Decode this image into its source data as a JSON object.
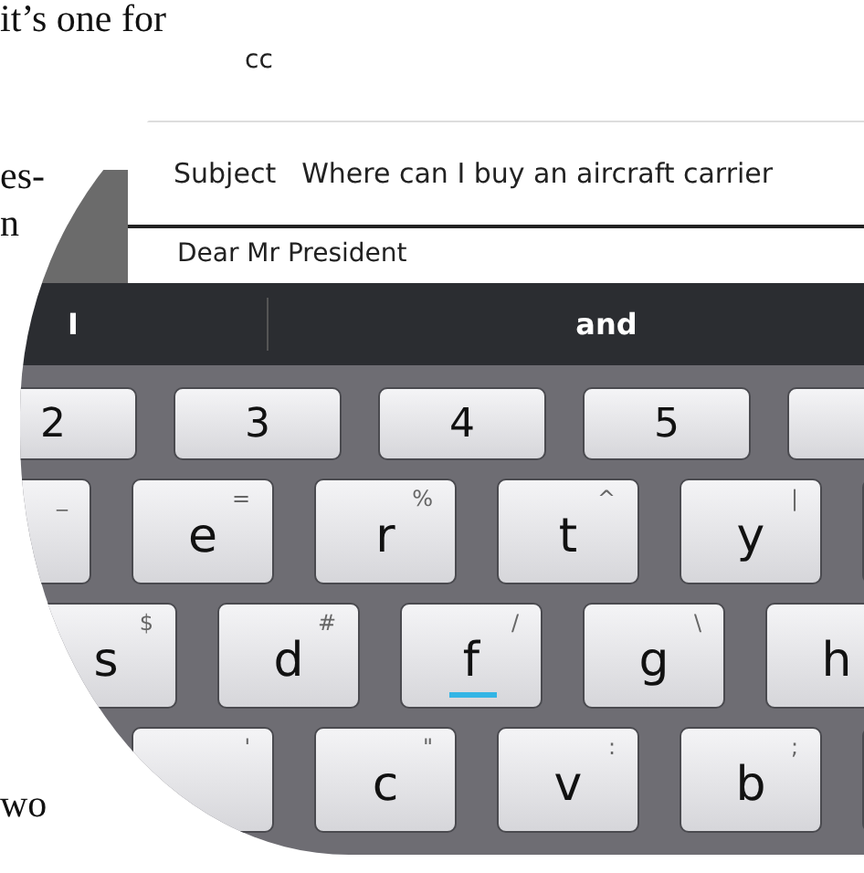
{
  "article_text": [
    "it’s one for",
    "es-",
    "n",
    "wo"
  ],
  "email": {
    "bcc_label": "cc",
    "subject_label": "Subject",
    "subject": "Where can I buy an aircraft carrier",
    "body": "Dear Mr President"
  },
  "suggestions": [
    "I",
    "and"
  ],
  "keyboard": {
    "rows": [
      [
        {
          "label": "2",
          "underlined": false
        },
        {
          "label": "3",
          "underlined": false
        },
        {
          "label": "4",
          "underlined": false
        },
        {
          "label": "5",
          "underlined": false
        },
        {
          "underlined": false
        }
      ],
      [
        {
          "alt": "_",
          "underlined": false
        },
        {
          "label": "e",
          "alt": "=",
          "underlined": false
        },
        {
          "label": "r",
          "alt": "%",
          "underlined": false
        },
        {
          "label": "t",
          "alt": "^",
          "underlined": false
        },
        {
          "label": "y",
          "alt": "|",
          "underlined": false
        },
        {
          "underlined": false
        }
      ],
      [
        {
          "label": "s",
          "alt": "$",
          "underlined": false
        },
        {
          "label": "d",
          "alt": "#",
          "underlined": false
        },
        {
          "label": "f",
          "alt": "/",
          "underlined": true
        },
        {
          "label": "g",
          "alt": "\\",
          "underlined": false
        },
        {
          "label": "h",
          "underlined": false
        }
      ],
      [
        {
          "alt": "'",
          "underlined": false
        },
        {
          "label": "c",
          "alt": "\"",
          "underlined": false
        },
        {
          "label": "v",
          "alt": ":",
          "underlined": false
        },
        {
          "label": "b",
          "alt": ";",
          "underlined": false
        },
        {
          "underlined": false
        }
      ]
    ]
  }
}
